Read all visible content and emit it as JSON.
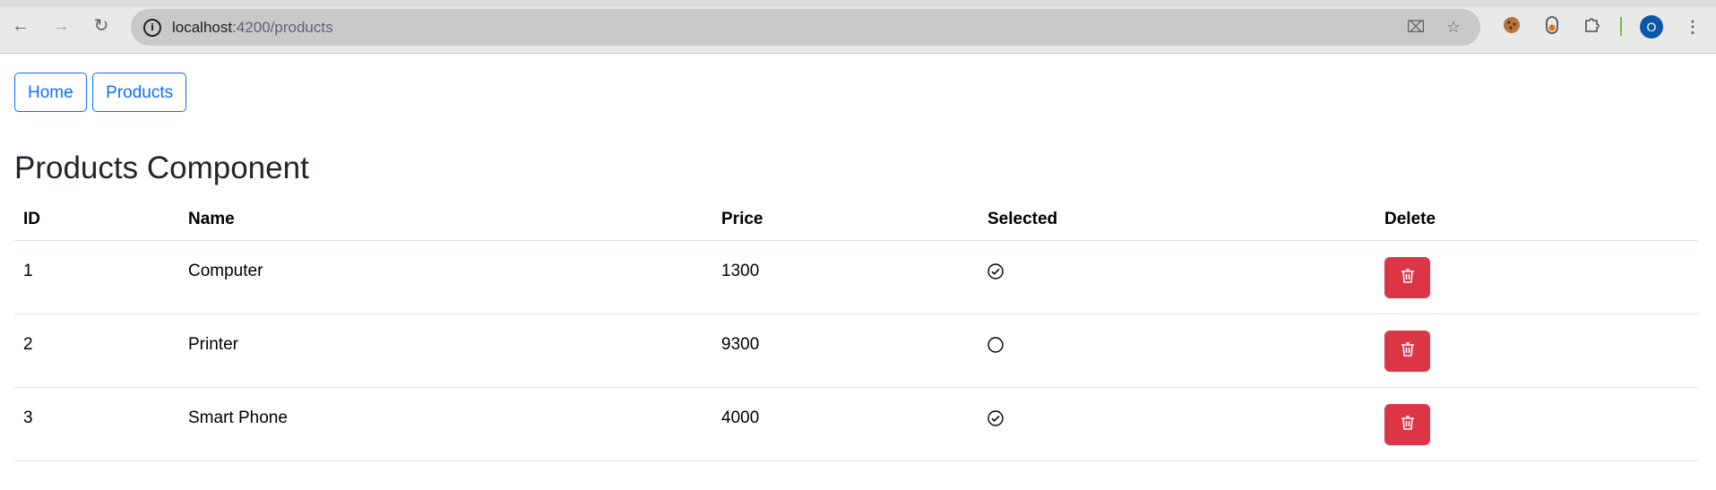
{
  "browser": {
    "url_host": "localhost",
    "url_path": ":4200/products",
    "avatar_letter": "O",
    "icons": [
      "back-icon",
      "forward-icon",
      "reload-icon",
      "info-icon",
      "translate-icon",
      "star-icon",
      "cookie-icon",
      "extension-icon",
      "puzzle-icon",
      "menu-icon"
    ]
  },
  "nav": {
    "home_label": "Home",
    "products_label": "Products"
  },
  "page": {
    "title": "Products Component"
  },
  "table": {
    "headers": {
      "id": "ID",
      "name": "Name",
      "price": "Price",
      "selected": "Selected",
      "delete": "Delete"
    },
    "rows": [
      {
        "id": "1",
        "name": "Computer",
        "price": "1300",
        "selected": true
      },
      {
        "id": "2",
        "name": "Printer",
        "price": "9300",
        "selected": false
      },
      {
        "id": "3",
        "name": "Smart Phone",
        "price": "4000",
        "selected": true
      }
    ]
  },
  "colors": {
    "primary": "#0d6efd",
    "danger": "#dc3545",
    "avatar": "#0b57a6"
  }
}
